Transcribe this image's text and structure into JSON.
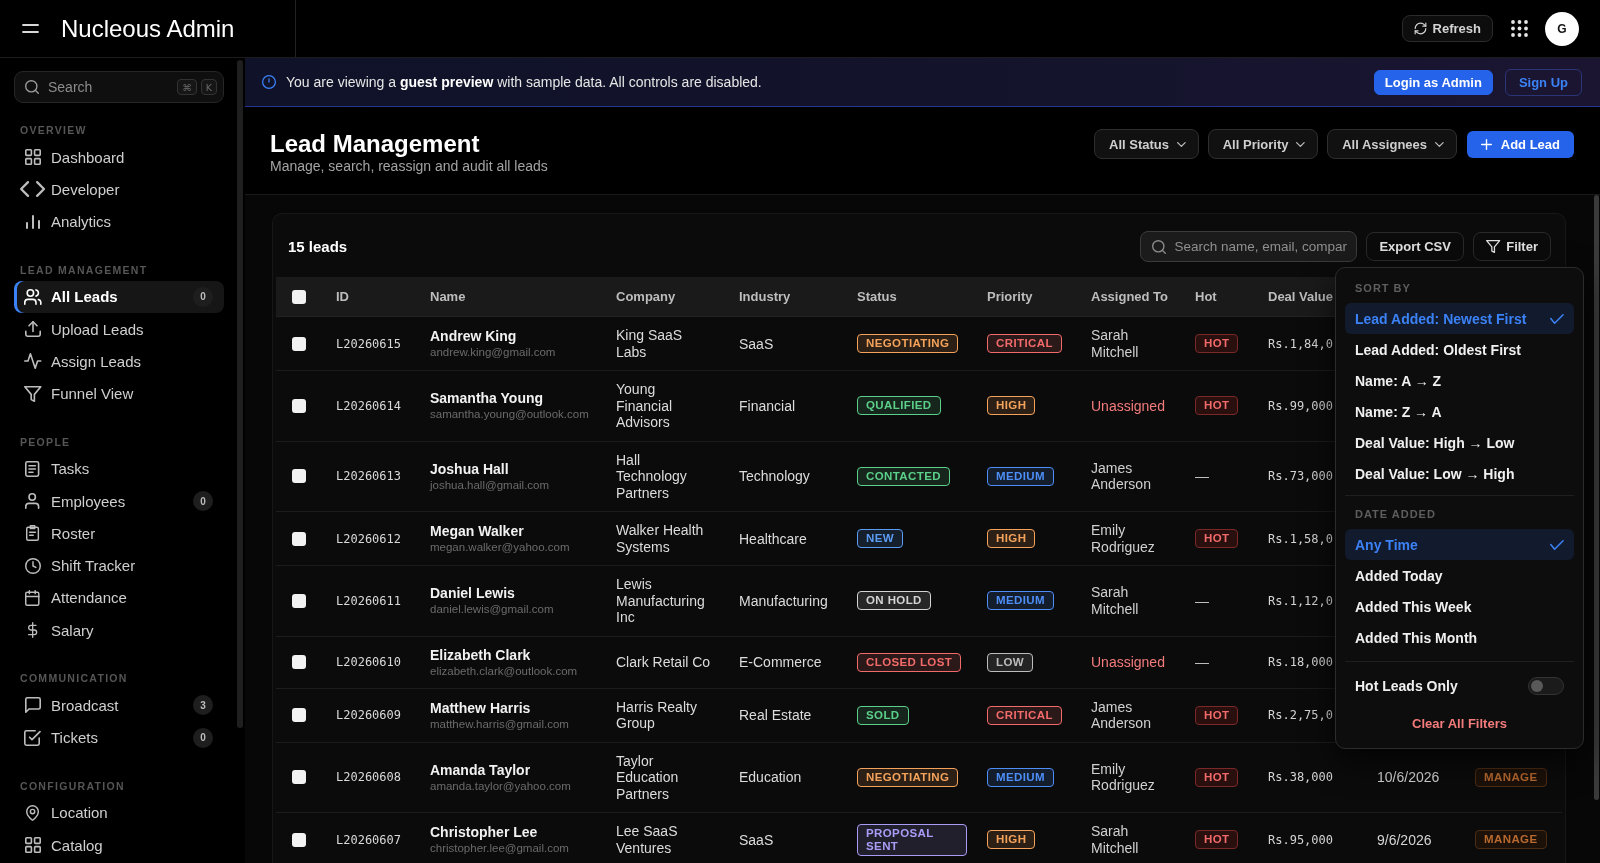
{
  "topbar": {
    "title": "Nucleous Admin",
    "refresh": "Refresh",
    "avatar": "G"
  },
  "sidebar": {
    "search": {
      "placeholder": "Search",
      "keys": [
        "⌘",
        "K"
      ]
    },
    "sections": [
      {
        "title": "OVERVIEW",
        "items": [
          {
            "label": "Dashboard",
            "selected": false
          },
          {
            "label": "Developer",
            "selected": false
          },
          {
            "label": "Analytics",
            "selected": false
          }
        ]
      },
      {
        "title": "LEAD MANAGEMENT",
        "items": [
          {
            "label": "All Leads",
            "selected": true,
            "count": "0"
          },
          {
            "label": "Upload Leads",
            "selected": false
          },
          {
            "label": "Assign Leads",
            "selected": false
          },
          {
            "label": "Funnel View",
            "selected": false
          }
        ]
      },
      {
        "title": "PEOPLE",
        "items": [
          {
            "label": "Tasks",
            "selected": false
          },
          {
            "label": "Employees",
            "selected": false,
            "count": "0"
          },
          {
            "label": "Roster",
            "selected": false
          },
          {
            "label": "Shift Tracker",
            "selected": false
          },
          {
            "label": "Attendance",
            "selected": false
          },
          {
            "label": "Salary",
            "selected": false
          }
        ]
      },
      {
        "title": "COMMUNICATION",
        "items": [
          {
            "label": "Broadcast",
            "selected": false,
            "count": "3"
          },
          {
            "label": "Tickets",
            "selected": false,
            "count": "0"
          }
        ]
      },
      {
        "title": "CONFIGURATION",
        "items": [
          {
            "label": "Location",
            "selected": false
          },
          {
            "label": "Catalog",
            "selected": false
          }
        ]
      }
    ]
  },
  "banner": {
    "text": "You are viewing a **guest preview** with sample data. All controls are disabled.",
    "actions": [
      {
        "label": "Login as Admin",
        "kind": "primary"
      },
      {
        "label": "Sign Up",
        "kind": "outline"
      }
    ]
  },
  "page_header": {
    "title": "Lead Management",
    "subtitle": "Manage, search, reassign and audit all leads",
    "filters": [
      {
        "label": "All Status"
      },
      {
        "label": "All Priority"
      },
      {
        "label": "All Assignees"
      }
    ],
    "add_button": "Add Lead"
  },
  "leads": {
    "count": "15 leads",
    "search": {
      "placeholder": "Search name, email, compar"
    },
    "export_button": "Export CSV",
    "filter_button": "Filter",
    "table": {
      "header_checkbox": {
        "checked": false
      },
      "columns": [
        "ID",
        "Name",
        "Company",
        "Industry",
        "Status",
        "Priority",
        "Assigned To",
        "Hot",
        "Deal Value"
      ],
      "rows": [
        {
          "checked": false,
          "id": "L20260615",
          "name": "Andrew King",
          "email": "andrew.king@gmail.com",
          "company": "King SaaS Labs",
          "industry": "SaaS",
          "status": {
            "label": "NEGOTIATING",
            "color": "#f5a35b"
          },
          "priority": {
            "label": "CRITICAL",
            "color": "#f26b6b"
          },
          "assigned": {
            "name": "Sarah Mitchell",
            "unassigned": false
          },
          "hot": {
            "kind": "badge",
            "label": "HOT"
          },
          "deal_value": "Rs.1,84,0"
        },
        {
          "checked": false,
          "id": "L20260614",
          "name": "Samantha Young",
          "email": "samantha.young@outlook.com",
          "company": "Young Financial Advisors",
          "industry": "Financial",
          "status": {
            "label": "QUALIFIED",
            "color": "#5ccf8a"
          },
          "priority": {
            "label": "HIGH",
            "color": "#f5a35b"
          },
          "assigned": {
            "name": "Unassigned",
            "unassigned": true
          },
          "hot": {
            "kind": "badge",
            "label": "HOT"
          },
          "deal_value": "Rs.99,000"
        },
        {
          "checked": false,
          "id": "L20260613",
          "name": "Joshua Hall",
          "email": "joshua.hall@gmail.com",
          "company": "Hall Technology Partners",
          "industry": "Technology",
          "status": {
            "label": "CONTACTED",
            "color": "#5ccf8a"
          },
          "priority": {
            "label": "MEDIUM",
            "color": "#4d8ef7"
          },
          "assigned": {
            "name": "James Anderson",
            "unassigned": false
          },
          "hot": {
            "kind": "none",
            "label": "—"
          },
          "deal_value": "Rs.73,000"
        },
        {
          "checked": false,
          "id": "L20260612",
          "name": "Megan Walker",
          "email": "megan.walker@yahoo.com",
          "company": "Walker Health Systems",
          "industry": "Healthcare",
          "status": {
            "label": "NEW",
            "color": "#5b9df5"
          },
          "priority": {
            "label": "HIGH",
            "color": "#f5a35b"
          },
          "assigned": {
            "name": "Emily Rodriguez",
            "unassigned": false
          },
          "hot": {
            "kind": "badge",
            "label": "HOT"
          },
          "deal_value": "Rs.1,58,0"
        },
        {
          "checked": false,
          "id": "L20260611",
          "name": "Daniel Lewis",
          "email": "daniel.lewis@gmail.com",
          "company": "Lewis Manufacturing Inc",
          "industry": "Manufacturing",
          "status": {
            "label": "ON HOLD",
            "color": "#d4d4d4"
          },
          "priority": {
            "label": "MEDIUM",
            "color": "#4d8ef7"
          },
          "assigned": {
            "name": "Sarah Mitchell",
            "unassigned": false
          },
          "hot": {
            "kind": "none",
            "label": "—"
          },
          "deal_value": "Rs.1,12,0"
        },
        {
          "checked": false,
          "id": "L20260610",
          "name": "Elizabeth Clark",
          "email": "elizabeth.clark@outlook.com",
          "company": "Clark Retail Co",
          "industry": "E-Commerce",
          "status": {
            "label": "CLOSED LOST",
            "color": "#f26b6b"
          },
          "priority": {
            "label": "LOW",
            "color": "#bdbdbd"
          },
          "assigned": {
            "name": "Unassigned",
            "unassigned": true
          },
          "hot": {
            "kind": "none",
            "label": "—"
          },
          "deal_value": "Rs.18,000"
        },
        {
          "checked": false,
          "id": "L20260609",
          "name": "Matthew Harris",
          "email": "matthew.harris@gmail.com",
          "company": "Harris Realty Group",
          "industry": "Real Estate",
          "status": {
            "label": "SOLD",
            "color": "#5ccf8a"
          },
          "priority": {
            "label": "CRITICAL",
            "color": "#f26b6b"
          },
          "assigned": {
            "name": "James Anderson",
            "unassigned": false
          },
          "hot": {
            "kind": "badge",
            "label": "HOT"
          },
          "deal_value": "Rs.2,75,0"
        },
        {
          "checked": false,
          "id": "L20260608",
          "name": "Amanda Taylor",
          "email": "amanda.taylor@yahoo.com",
          "company": "Taylor Education Partners",
          "industry": "Education",
          "status": {
            "label": "NEGOTIATING",
            "color": "#f5a35b"
          },
          "priority": {
            "label": "MEDIUM",
            "color": "#4d8ef7"
          },
          "assigned": {
            "name": "Emily Rodriguez",
            "unassigned": false
          },
          "hot": {
            "kind": "badge",
            "label": "HOT"
          },
          "deal_value": "Rs.38,000",
          "date": "10/6/2026",
          "action": "MANAGE"
        },
        {
          "checked": false,
          "id": "L20260607",
          "name": "Christopher Lee",
          "email": "christopher.lee@gmail.com",
          "company": "Lee SaaS Ventures",
          "industry": "SaaS",
          "status": {
            "label": "PROPOSAL SENT",
            "color": "#a89cf7"
          },
          "priority": {
            "label": "HIGH",
            "color": "#f5a35b"
          },
          "assigned": {
            "name": "Sarah Mitchell",
            "unassigned": false
          },
          "hot": {
            "kind": "badge",
            "label": "HOT"
          },
          "deal_value": "Rs.95,000",
          "date": "9/6/2026",
          "action": "MANAGE"
        }
      ]
    },
    "filter_menu": {
      "sections": [
        {
          "title": "SORT BY",
          "options": [
            {
              "label": "Lead Added: Newest First",
              "selected": true
            },
            {
              "label": "Lead Added: Oldest First",
              "selected": false
            },
            {
              "label": "Name: A → Z",
              "selected": false
            },
            {
              "label": "Name: Z → A",
              "selected": false
            },
            {
              "label": "Deal Value: High → Low",
              "selected": false
            },
            {
              "label": "Deal Value: Low → High",
              "selected": false
            }
          ]
        },
        {
          "title": "DATE ADDED",
          "options": [
            {
              "label": "Any Time",
              "selected": true
            },
            {
              "label": "Added Today",
              "selected": false
            },
            {
              "label": "Added This Week",
              "selected": false
            },
            {
              "label": "Added This Month",
              "selected": false
            }
          ]
        }
      ],
      "hot_leads_only": {
        "label": "Hot Leads Only",
        "on": false
      },
      "clear_button": "Clear All Filters"
    }
  }
}
